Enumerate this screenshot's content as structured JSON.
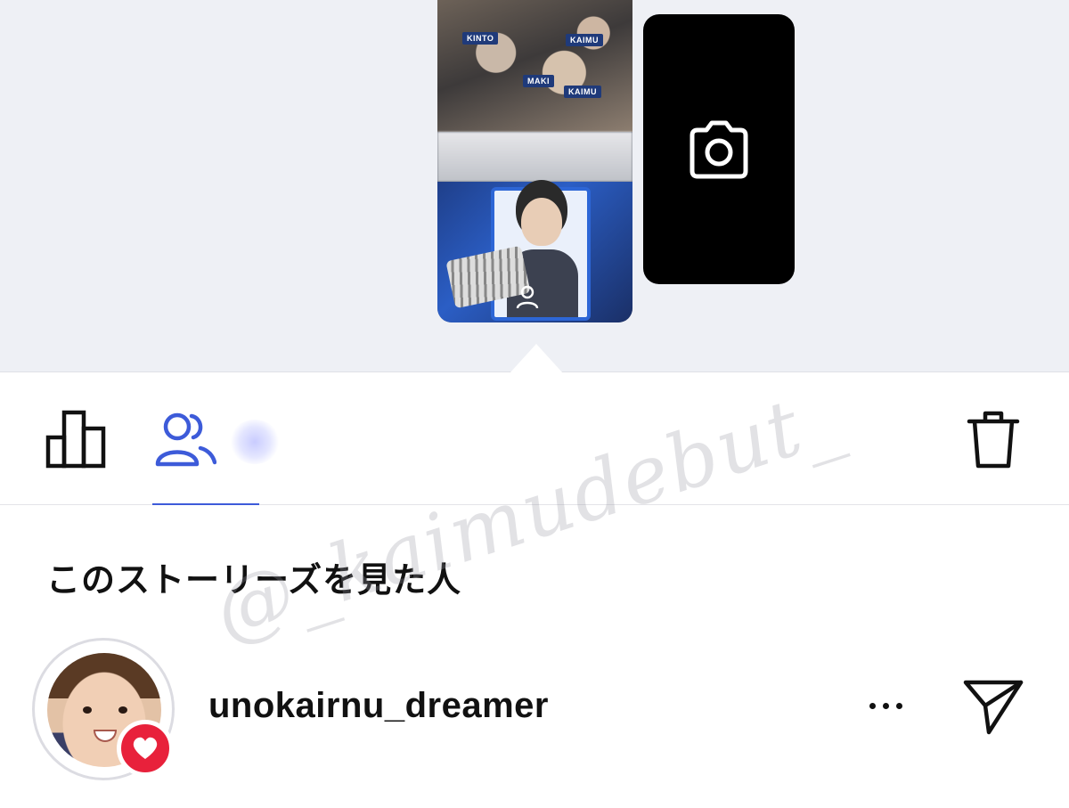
{
  "story_preview": {
    "nametags": [
      "KINTO",
      "KAIMU",
      "MAKI",
      "KAIMU"
    ]
  },
  "camera_tile": {
    "icon": "camera-icon"
  },
  "toolbar": {
    "insights_icon": "bar-chart-icon",
    "viewers_icon": "people-icon",
    "delete_icon": "trash-icon",
    "active_tab": "viewers",
    "accent_color": "#3d5bd9"
  },
  "viewers_section": {
    "title": "このストーリーズを見た人"
  },
  "viewer": {
    "username": "unokairnu_dreamer",
    "badge_icon": "heart-icon",
    "badge_color": "#e8213b"
  },
  "watermark": "@_kaimudebut_"
}
